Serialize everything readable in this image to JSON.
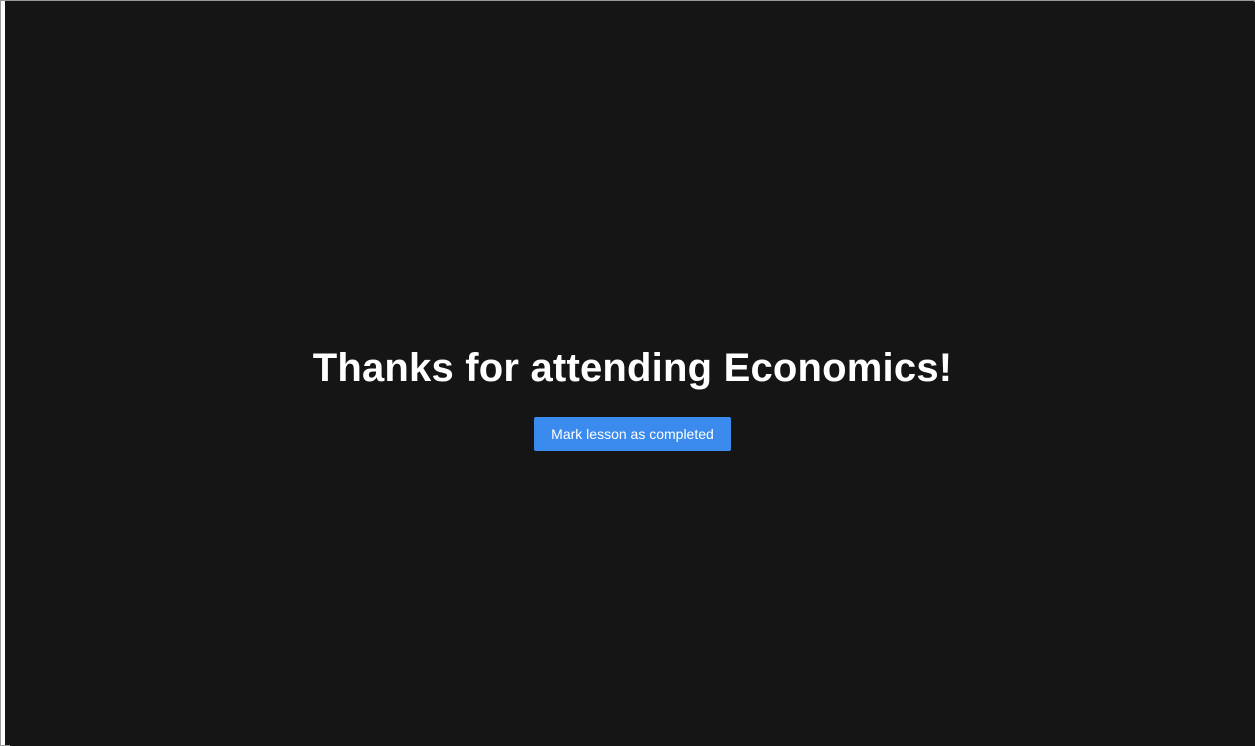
{
  "lesson": {
    "heading": "Thanks for attending Economics!",
    "complete_button_label": "Mark lesson as completed"
  },
  "colors": {
    "background": "#151515",
    "heading_text": "#ffffff",
    "button_background": "#3a8bed",
    "button_text": "#ffffff"
  }
}
